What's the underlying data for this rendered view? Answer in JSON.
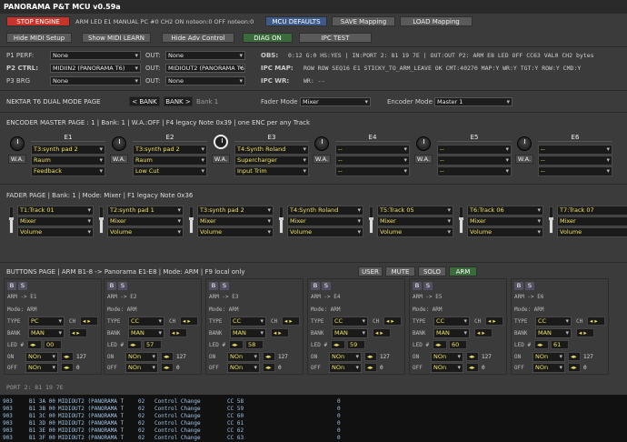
{
  "window": {
    "title": "PANORAMA P&T MCU v0.59a"
  },
  "toolbar": {
    "stop_engine": "STOP ENGINE",
    "status": "ARM LED E1 MANUAL PC #0 CH2 ON noteon:0 OFF noteon:0",
    "mcu_defaults": "MCU DEFAULTS",
    "save_mapping": "SAVE Mapping",
    "load_mapping": "LOAD Mapping"
  },
  "toolbar2": {
    "hide_midi_setup": "Hide MIDI Setup",
    "show_midi_learn": "Show MIDI LEARN",
    "hide_adv_control": "Hide Adv Control",
    "diag_on": "DIAG ON",
    "ipc_test": "IPC TEST"
  },
  "midi": {
    "p1_label": "P1 PERF:",
    "p1_in": "None",
    "p1_out_label": "OUT:",
    "p1_out": "None",
    "p2_label": "P2 CTRL:",
    "p2_in": "MIDIIN2 (PANORAMA T6)",
    "p2_out_label": "OUT:",
    "p2_out": "MIDIOUT2 (PANORAMA T6)",
    "p3_label": "P3 BRG",
    "p3_in": "None",
    "p3_out_label": "OUT:",
    "p3_out": "None",
    "obs_label": "OBS:",
    "obs_text": "0:12 G:0 HS:YES | IN:PORT 2: 81 19 7E | OUT:OUT P2: ARM E8 LED OFF CC63 VAL0 CH2 bytes",
    "ipc_map_label": "IPC MAP:",
    "ipc_map_text": "ROW ROW SEQ16 E1 STICKY_TO_ARM_LEAVE OK CMT:40270 MAP:Y WR:Y TGT:Y ROW:Y CMD:Y",
    "ipc_wr_label": "IPC WR:",
    "ipc_wr_text": "WR: --"
  },
  "nektar": {
    "title": "NEKTAR T6 DUAL MODE PAGE",
    "bank_prev": "< BANK",
    "bank_next": "BANK >",
    "bank_label": "Bank 1",
    "fader_mode_label": "Fader Mode",
    "fader_mode": "Mixer",
    "encoder_mode_label": "Encoder Mode",
    "encoder_mode": "Master 1"
  },
  "encoder": {
    "title": "ENCODER MASTER PAGE : 1 | Bank: 1 | W.A.:OFF | F4 legacy Note 0x39 | one ENC per any Track",
    "wa": "W.A.",
    "channels": [
      {
        "name": "E1",
        "track": "T3:synth pad 2",
        "fx": "Raum",
        "param": "Feedback"
      },
      {
        "name": "E2",
        "track": "T3:synth pad 2",
        "fx": "Raum",
        "param": "Low Cut"
      },
      {
        "name": "E3",
        "track": "T4:Synth Roland",
        "fx": "Supercharger",
        "param": "Input Trim"
      },
      {
        "name": "E4",
        "track": "--",
        "fx": "--",
        "param": "--"
      },
      {
        "name": "E5",
        "track": "--",
        "fx": "--",
        "param": "--"
      },
      {
        "name": "E6",
        "track": "--",
        "fx": "--",
        "param": "--"
      }
    ]
  },
  "fader": {
    "title": "FADER PAGE | Bank: 1 | Mode: Mixer | F1 legacy Note 0x36",
    "channels": [
      {
        "track": "T1:Track 01",
        "mode": "Mixer",
        "param": "Volume",
        "level": 0.6
      },
      {
        "track": "T2:synth pad 1",
        "mode": "Mixer",
        "param": "Volume",
        "level": 0.6
      },
      {
        "track": "T3:synth pad 2",
        "mode": "Mixer",
        "param": "Volume",
        "level": 0.6
      },
      {
        "track": "T4:Synth Roland",
        "mode": "Mixer",
        "param": "Volume",
        "level": 0.6
      },
      {
        "track": "T5:Track 05",
        "mode": "Mixer",
        "param": "Volume",
        "level": 0.6
      },
      {
        "track": "T6:Track 06",
        "mode": "Mixer",
        "param": "Volume",
        "level": 0.6
      },
      {
        "track": "T7:Track 07",
        "mode": "Mixer",
        "param": "Volume",
        "level": 0.6
      }
    ]
  },
  "buttons": {
    "title": "BUTTONS PAGE | ARM B1-8 -> Panorama E1-E8 | Mode: ARM | F9 local only",
    "tabs": [
      "USER",
      "MUTE",
      "SOLO",
      "ARM"
    ],
    "b": "B",
    "s": "S",
    "mode": "Mode: ARM",
    "type_label": "TYPE",
    "ch_label": "CH",
    "bank_label": "BANK",
    "led_label": "LED #",
    "on_label": "ON",
    "off_label": "OFF",
    "panels": [
      {
        "arm": "ARM -> E1",
        "type": "PC",
        "bank": "MAN",
        "led": "00",
        "on": "NOn",
        "on_val": "127",
        "off": "NOn",
        "off_val": "0"
      },
      {
        "arm": "ARM -> E2",
        "type": "CC",
        "bank": "MAN",
        "led": "57",
        "on": "NOn",
        "on_val": "127",
        "off": "NOn",
        "off_val": "0"
      },
      {
        "arm": "ARM -> E3",
        "type": "CC",
        "bank": "MAN",
        "led": "58",
        "on": "NOn",
        "on_val": "127",
        "off": "NOn",
        "off_val": "0"
      },
      {
        "arm": "ARM -> E4",
        "type": "CC",
        "bank": "MAN",
        "led": "59",
        "on": "NOn",
        "on_val": "127",
        "off": "NOn",
        "off_val": "0"
      },
      {
        "arm": "ARM -> E5",
        "type": "CC",
        "bank": "MAN",
        "led": "60",
        "on": "NOn",
        "on_val": "127",
        "off": "NOn",
        "off_val": "0"
      },
      {
        "arm": "ARM -> E6",
        "type": "CC",
        "bank": "MAN",
        "led": "61",
        "on": "NOn",
        "on_val": "127",
        "off": "NOn",
        "off_val": "0"
      }
    ]
  },
  "port_status": "PORT 2: 81 19 7E",
  "log": [
    [
      "903",
      "B1 3A 00",
      "MIDIOUT2 (PANORAMA T",
      "02",
      "Control Change",
      "CC 58",
      "0"
    ],
    [
      "903",
      "B1 3B 00",
      "MIDIOUT2 (PANORAMA T",
      "02",
      "Control Change",
      "CC 59",
      "0"
    ],
    [
      "903",
      "B1 3C 00",
      "MIDIOUT2 (PANORAMA T",
      "02",
      "Control Change",
      "CC 60",
      "0"
    ],
    [
      "903",
      "B1 3D 00",
      "MIDIOUT2 (PANORAMA T",
      "02",
      "Control Change",
      "CC 61",
      "0"
    ],
    [
      "903",
      "B1 3E 00",
      "MIDIOUT2 (PANORAMA T",
      "02",
      "Control Change",
      "CC 62",
      "0"
    ],
    [
      "903",
      "B1 3F 00",
      "MIDIOUT2 (PANORAMA T",
      "02",
      "Control Change",
      "CC 63",
      "0"
    ]
  ]
}
